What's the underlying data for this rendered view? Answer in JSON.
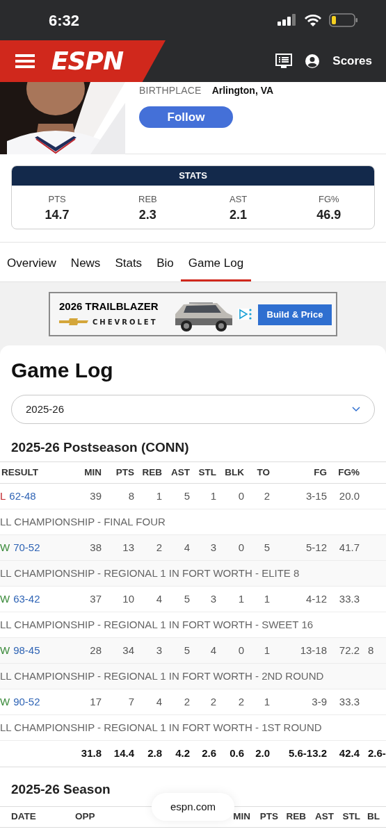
{
  "status_bar": {
    "time": "6:32"
  },
  "nav": {
    "logo": "ESPN",
    "scores_link": "Scores"
  },
  "profile": {
    "birthplace_label": "BIRTHPLACE",
    "birthplace": "Arlington, VA",
    "follow_button": "Follow"
  },
  "stats_card": {
    "title": "STATS",
    "stats": [
      {
        "label": "PTS",
        "value": "14.7"
      },
      {
        "label": "REB",
        "value": "2.3"
      },
      {
        "label": "AST",
        "value": "2.1"
      },
      {
        "label": "FG%",
        "value": "46.9"
      }
    ]
  },
  "tabs": [
    {
      "label": "Overview",
      "selected": false
    },
    {
      "label": "News",
      "selected": false
    },
    {
      "label": "Stats",
      "selected": false
    },
    {
      "label": "Bio",
      "selected": false
    },
    {
      "label": "Game Log",
      "selected": true
    }
  ],
  "ad": {
    "headline": "2026 TRAILBLAZER",
    "brand": "CHEVROLET",
    "cta": "Build & Price"
  },
  "game_log": {
    "title": "Game Log",
    "season_select": {
      "value": "2025-26"
    },
    "postseason": {
      "title": "2025-26 Postseason (CONN)",
      "columns": [
        "RESULT",
        "MIN",
        "PTS",
        "REB",
        "AST",
        "STL",
        "BLK",
        "TO",
        "FG",
        "FG%"
      ],
      "games": [
        {
          "outcome": "L",
          "kind": "loss",
          "score": "62-48",
          "stats": [
            "39",
            "8",
            "1",
            "5",
            "1",
            "0",
            "2",
            "3-15",
            "20.0"
          ],
          "event": "LL CHAMPIONSHIP - FINAL FOUR"
        },
        {
          "outcome": "W",
          "kind": "win",
          "score": "70-52",
          "stats": [
            "38",
            "13",
            "2",
            "4",
            "3",
            "0",
            "5",
            "5-12",
            "41.7"
          ],
          "event": "LL CHAMPIONSHIP - REGIONAL 1 IN FORT WORTH - ELITE 8"
        },
        {
          "outcome": "W",
          "kind": "win",
          "score": "63-42",
          "stats": [
            "37",
            "10",
            "4",
            "5",
            "3",
            "1",
            "1",
            "4-12",
            "33.3"
          ],
          "event": "LL CHAMPIONSHIP - REGIONAL 1 IN FORT WORTH - SWEET 16"
        },
        {
          "outcome": "W",
          "kind": "win",
          "score": "98-45",
          "stats": [
            "28",
            "34",
            "3",
            "5",
            "4",
            "0",
            "1",
            "13-18",
            "72.2"
          ],
          "overflow": "8",
          "event": "LL CHAMPIONSHIP - REGIONAL 1 IN FORT WORTH - 2ND ROUND"
        },
        {
          "outcome": "W",
          "kind": "win",
          "score": "90-52",
          "stats": [
            "17",
            "7",
            "4",
            "2",
            "2",
            "2",
            "1",
            "3-9",
            "33.3"
          ],
          "event": "LL CHAMPIONSHIP - REGIONAL 1 IN FORT WORTH - 1ST ROUND"
        }
      ],
      "totals": [
        "31.8",
        "14.4",
        "2.8",
        "4.2",
        "2.6",
        "0.6",
        "2.0",
        "5.6-13.2",
        "42.4"
      ],
      "totals_overflow": "2.6-"
    },
    "season": {
      "title": "2025-26 Season",
      "columns": [
        "DATE",
        "OPP",
        "MIN",
        "PTS",
        "REB",
        "AST",
        "STL",
        "BL"
      ]
    }
  },
  "url_pill": "espn.com"
}
